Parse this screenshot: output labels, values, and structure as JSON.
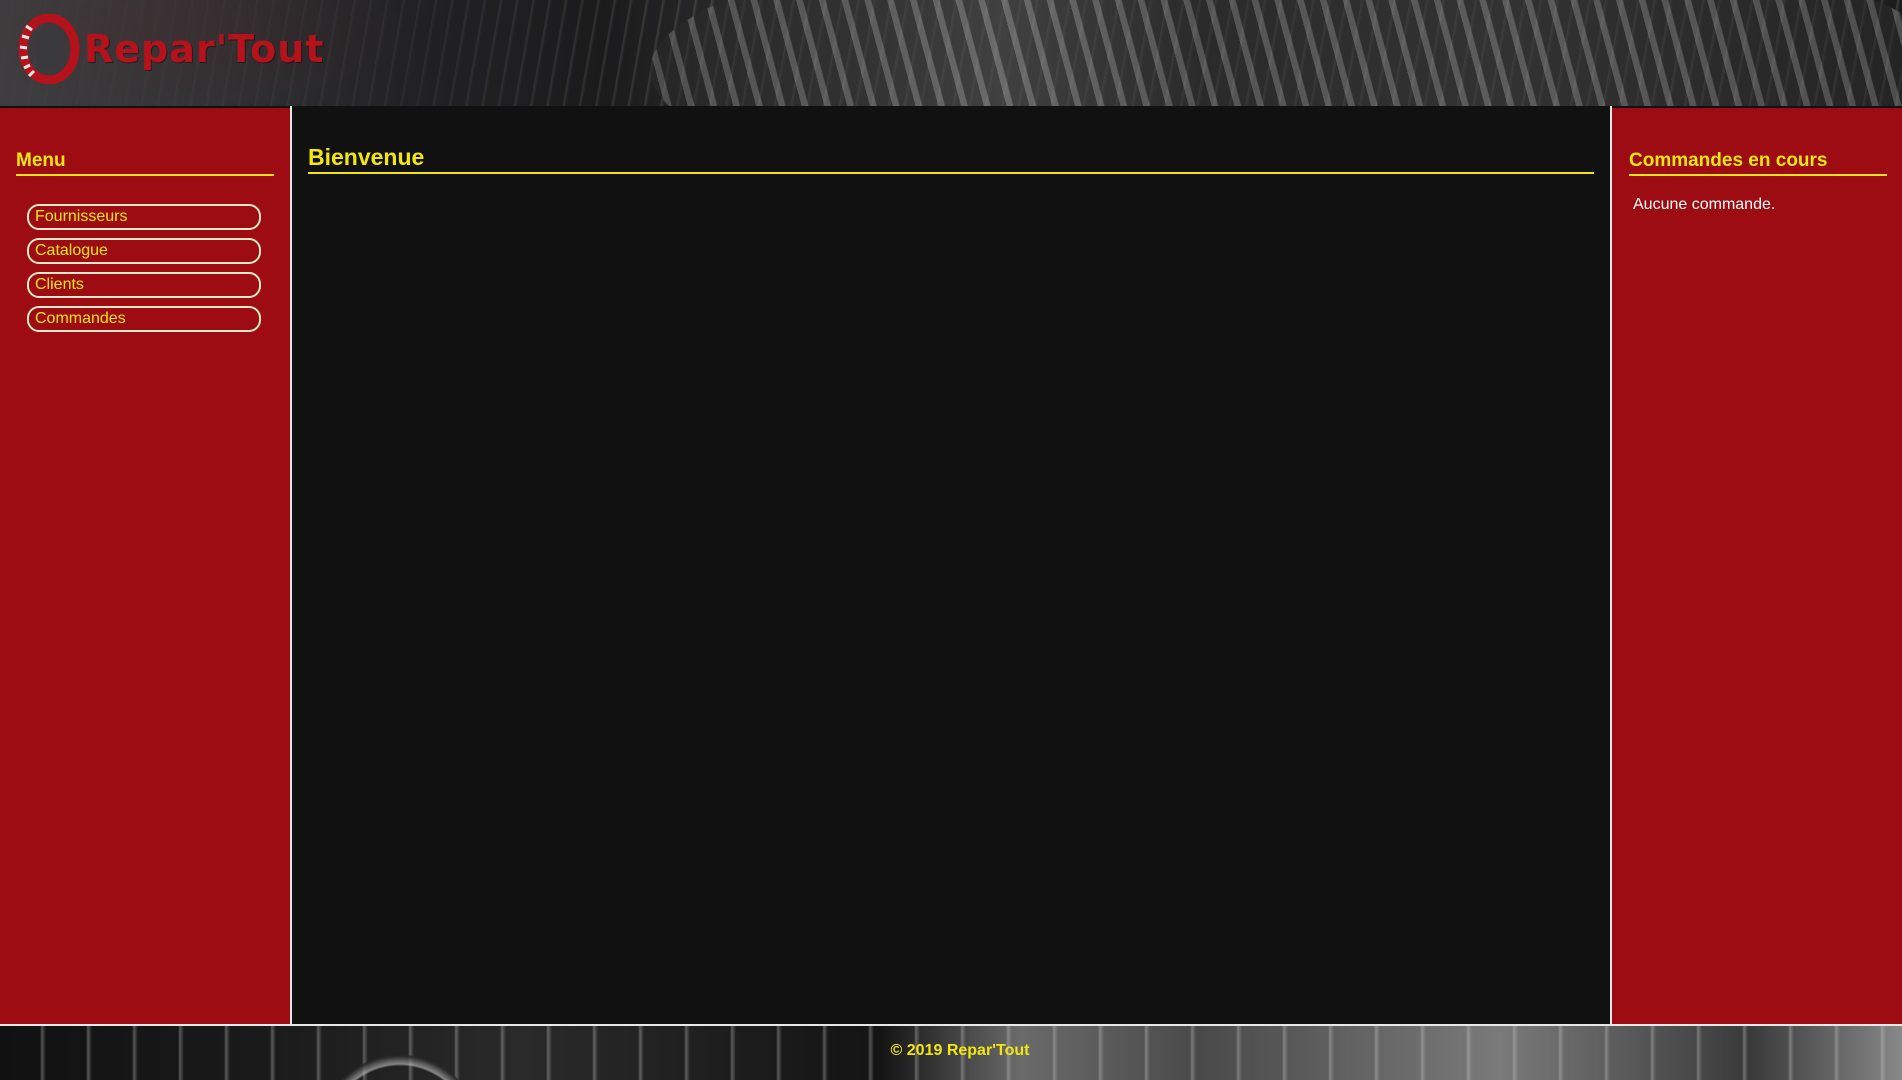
{
  "header": {
    "brand": "Repar'Tout",
    "logo_icon": "tire-icon"
  },
  "menu": {
    "title": "Menu",
    "items": [
      {
        "label": "Fournisseurs"
      },
      {
        "label": "Catalogue"
      },
      {
        "label": "Clients"
      },
      {
        "label": "Commandes"
      }
    ]
  },
  "main": {
    "title": "Bienvenue"
  },
  "orders": {
    "title": "Commandes en cours",
    "empty_text": "Aucune commande."
  },
  "footer": {
    "text": "© 2019 Repar'Tout"
  },
  "colors": {
    "sidebar_bg": "#9c0c12",
    "accent_yellow": "#f2e611",
    "main_bg": "#111111",
    "brand_red": "#b5121b"
  }
}
